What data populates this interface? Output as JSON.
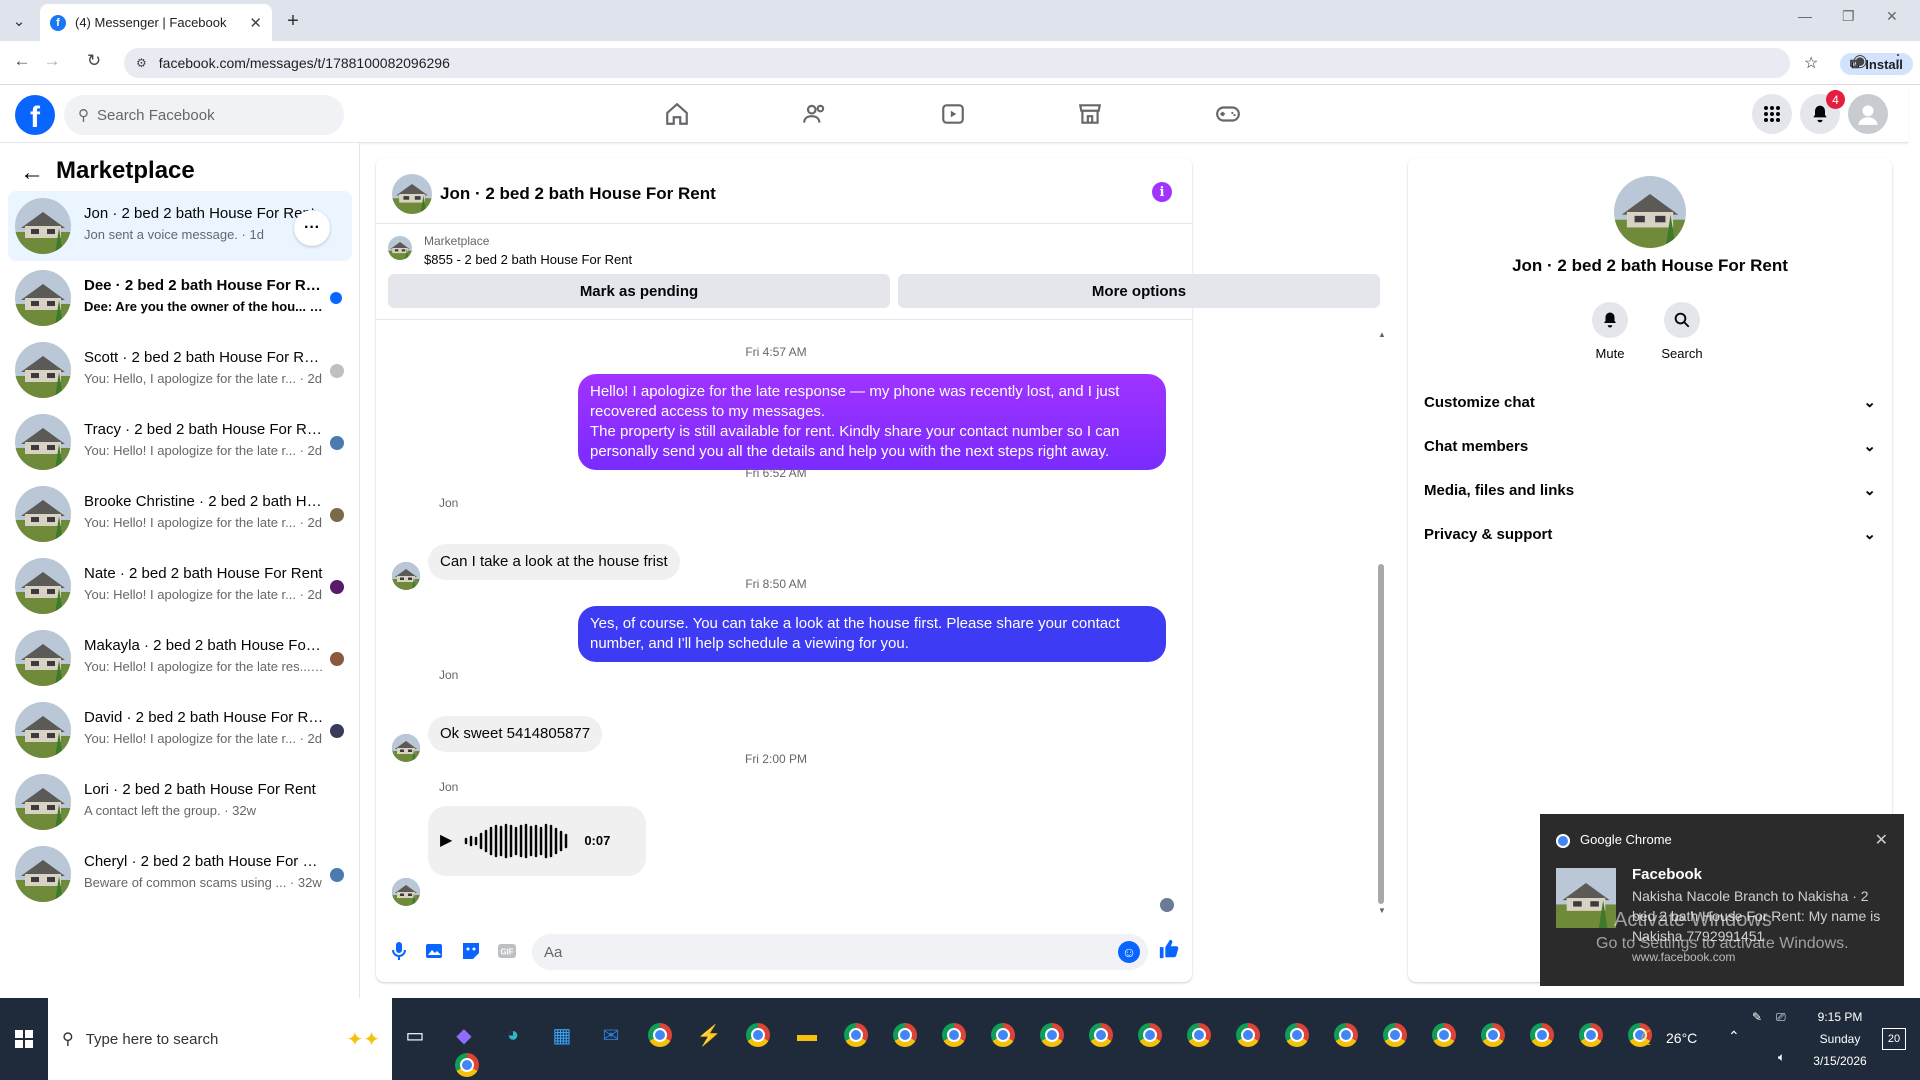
{
  "browser": {
    "tab_title": "(4) Messenger | Facebook",
    "url": "facebook.com/messages/t/1788100082096296",
    "install_label": "Install"
  },
  "header": {
    "search_placeholder": "Search Facebook",
    "notification_count": "4"
  },
  "sidebar": {
    "title": "Marketplace",
    "conversations": [
      {
        "name": "Jon · 2 bed 2 bath House For Rent",
        "preview": "Jon sent a voice message. · 1d",
        "active": true
      },
      {
        "name": "Dee · 2 bed 2 bath House For Rent",
        "preview": "Dee: Are you the owner of the hou... · 1d",
        "unread": true
      },
      {
        "name": "Scott · 2 bed 2 bath House For Rent",
        "preview": "You: Hello, I apologize for the late r... · 2d"
      },
      {
        "name": "Tracy · 2 bed 2 bath House For Rent",
        "preview": "You: Hello! I apologize for the late r... · 2d"
      },
      {
        "name": "Brooke Christine · 2 bed 2 bath House For Rent",
        "preview": "You: Hello! I apologize for the late r... · 2d"
      },
      {
        "name": "Nate · 2 bed 2 bath House For Rent",
        "preview": "You: Hello! I apologize for the late r... · 2d"
      },
      {
        "name": "Makayla · 2 bed 2 bath House For Rent",
        "preview": "You: Hello! I apologize for the late res... · 2d"
      },
      {
        "name": "David · 2 bed 2 bath House For Rent",
        "preview": "You: Hello! I apologize for the late r... · 2d"
      },
      {
        "name": "Lori · 2 bed 2 bath House For Rent",
        "preview": "A contact left the group. · 32w"
      },
      {
        "name": "Cheryl · 2 bed 2 bath House For Rent",
        "preview": "Beware of common scams using ... · 32w"
      }
    ]
  },
  "chat": {
    "title": "Jon · 2 bed 2 bath House For Rent",
    "marketplace_label": "Marketplace",
    "listing": "$855 - 2 bed 2 bath House For Rent",
    "mark_pending": "Mark as pending",
    "more_options": "More options",
    "messages": {
      "ts1": "Fri 4:57 AM",
      "out1": "Hello! I apologize for the late response — my phone was recently lost, and I just recovered access to my messages.\nThe property is still available for rent. Kindly share your contact number so I can personally send you all the details and help you with the next steps right away.",
      "ts2": "Fri 6:52 AM",
      "sender1": "Jon",
      "in1": "Can I take a look at the house frist",
      "ts3": "Fri 8:50 AM",
      "out2": "Yes, of course. You can take a look at the house first. Please share your contact number, and I'll help schedule a viewing for you.",
      "sender2": "Jon",
      "in2": "Ok sweet 5414805877",
      "ts4": "Fri 2:00 PM",
      "sender3": "Jon",
      "voice_duration": "0:07"
    },
    "composer_placeholder": "Aa"
  },
  "info": {
    "name": "Jon · 2 bed 2 bath House For Rent",
    "mute": "Mute",
    "search": "Search",
    "rows": [
      "Customize chat",
      "Chat members",
      "Media, files and links",
      "Privacy & support"
    ]
  },
  "toast": {
    "app": "Google Chrome",
    "title": "Facebook",
    "body": "Nakisha Nacole Branch to Nakisha · 2 bed 2 bath House For Rent: My name is Nakisha 7792991451",
    "url": "www.facebook.com"
  },
  "watermark": {
    "line1": "Activate Windows",
    "line2": "Go to Settings to activate Windows."
  },
  "taskbar": {
    "search_placeholder": "Type here to search",
    "temperature": "26°C",
    "time": "9:15 PM",
    "day": "Sunday",
    "date": "3/15/2026",
    "notif_count": "20"
  },
  "colors": {
    "fb_blue": "#0866ff",
    "bubble_purple": "#a033ff",
    "bubble_blue": "#3d3bf3"
  }
}
